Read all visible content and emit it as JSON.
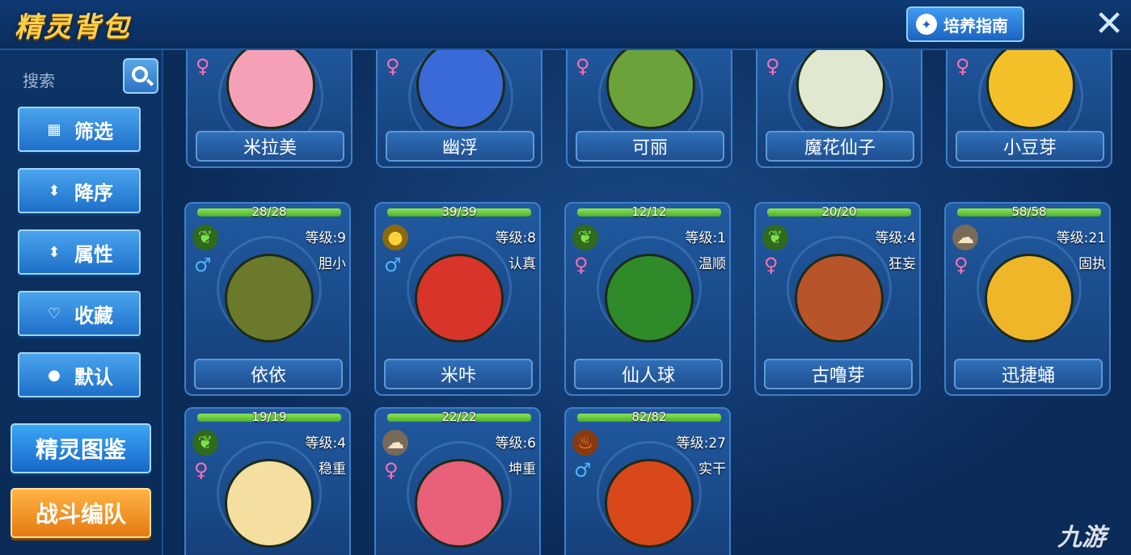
{
  "header": {
    "title": "精灵背包",
    "guide_label": "培养指南",
    "close_icon": "✕"
  },
  "sidebar": {
    "search_placeholder": "搜索",
    "buttons": [
      {
        "label": "筛选",
        "icon": "grid-icon",
        "glyph": "▦"
      },
      {
        "label": "降序",
        "icon": "sort-icon",
        "glyph": "⬍"
      },
      {
        "label": "属性",
        "icon": "attribute-icon",
        "glyph": "⬍"
      },
      {
        "label": "收藏",
        "icon": "heart-icon",
        "glyph": "♡"
      },
      {
        "label": "默认",
        "icon": "flame-icon",
        "glyph": "●"
      }
    ],
    "handbook_label": "精灵图鉴",
    "team_label": "战斗编队"
  },
  "row1": [
    {
      "name": "米拉美",
      "gender": "♀"
    },
    {
      "name": "幽浮",
      "gender": "♀"
    },
    {
      "name": "可丽",
      "gender": "♀"
    },
    {
      "name": "魔花仙子",
      "gender": "♀"
    },
    {
      "name": "小豆芽",
      "gender": "♀"
    }
  ],
  "row2": [
    {
      "name": "依依",
      "hp": "28/28",
      "hp_fraction": 1.0,
      "level": "等级:9",
      "nature": "胆小",
      "gender": "♂",
      "element": "grass",
      "elem_glyph": "❦",
      "elem_color": "#5cc83a",
      "body": "#6b7a2a"
    },
    {
      "name": "米咔",
      "hp": "39/39",
      "hp_fraction": 1.0,
      "level": "等级:8",
      "nature": "认真",
      "gender": "♂",
      "element": "light",
      "elem_glyph": "●",
      "elem_color": "#f5c21b",
      "body": "#d8342a"
    },
    {
      "name": "仙人球",
      "hp": "12/12",
      "hp_fraction": 1.0,
      "level": "等级:1",
      "nature": "温顺",
      "gender": "♀",
      "element": "grass",
      "elem_glyph": "❦",
      "elem_color": "#5cc83a",
      "body": "#2f8a2a"
    },
    {
      "name": "古噜芽",
      "hp": "20/20",
      "hp_fraction": 1.0,
      "level": "等级:4",
      "nature": "狂妄",
      "gender": "♀",
      "element": "grass",
      "elem_glyph": "❦",
      "elem_color": "#5cc83a",
      "body": "#b8542a"
    },
    {
      "name": "迅捷蛹",
      "hp": "58/58",
      "hp_fraction": 1.0,
      "level": "等级:21",
      "nature": "固执",
      "gender": "♀",
      "element": "wing",
      "elem_glyph": "☁",
      "elem_color": "#f2d8b0",
      "body": "#f0b62a"
    }
  ],
  "row3": [
    {
      "hp": "19/19",
      "hp_fraction": 1.0,
      "level": "等级:4",
      "nature": "稳重",
      "gender": "♀",
      "element": "grass",
      "elem_glyph": "❦",
      "elem_color": "#5cc83a",
      "body": "#f4dfa0"
    },
    {
      "hp": "22/22",
      "hp_fraction": 1.0,
      "level": "等级:6",
      "nature": "坤重",
      "gender": "♀",
      "element": "wing",
      "elem_glyph": "☁",
      "elem_color": "#f2d8b0",
      "body": "#e8607a"
    },
    {
      "hp": "82/82",
      "hp_fraction": 1.0,
      "level": "等级:27",
      "nature": "实干",
      "gender": "♂",
      "element": "fire",
      "elem_glyph": "♨",
      "elem_color": "#ff7a1a",
      "body": "#d8481a"
    }
  ],
  "row1_colors": [
    "#f6a0b8",
    "#3a6ad8",
    "#6ba23a",
    "#e0e8d0",
    "#f4c02a"
  ],
  "watermark": "九游"
}
